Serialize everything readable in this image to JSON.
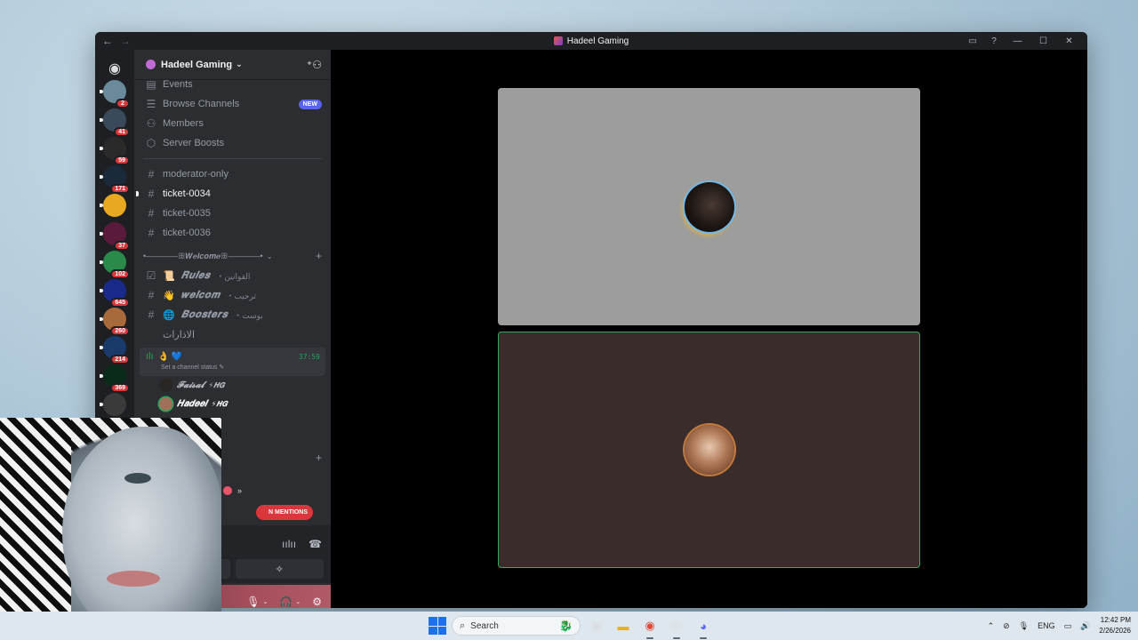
{
  "window": {
    "title": "Hadeel Gaming",
    "nav_back": "←",
    "nav_forward": "→",
    "controls": {
      "inbox_icon": "inbox-icon",
      "help_icon": "help-icon",
      "minimize": "—",
      "maximize": "☐",
      "close": "✕"
    }
  },
  "rail": {
    "home_icon": "discord-logo-icon",
    "servers": [
      {
        "badge": "2",
        "color": "#6a8a9c"
      },
      {
        "badge": "41",
        "color": "#3a4a5a"
      },
      {
        "badge": "59",
        "color": "#2a2a2a"
      },
      {
        "badge": "171",
        "color": "#1a2a3a"
      },
      {
        "badge": "",
        "color": "#e8a820"
      },
      {
        "badge": "37",
        "color": "#5a1a3a"
      },
      {
        "badge": "102",
        "color": "#2a8a4a"
      },
      {
        "badge": "645",
        "color": "#1a2a8a"
      },
      {
        "badge": "260",
        "color": "#a86a3a"
      },
      {
        "badge": "214",
        "color": "#1a3a6a"
      },
      {
        "badge": "369",
        "color": "#0a2a1a"
      },
      {
        "badge": "",
        "color": "#3a3a3a"
      }
    ]
  },
  "server": {
    "name": "Hadeel Gaming",
    "nav": [
      {
        "label": "Events",
        "icon": "calendar-icon"
      },
      {
        "label": "Browse Channels",
        "icon": "browse-channels-icon",
        "badge": "NEW"
      },
      {
        "label": "Members",
        "icon": "members-icon"
      },
      {
        "label": "Server Boosts",
        "icon": "boost-icon"
      }
    ],
    "channels": [
      {
        "name": "moderator-only",
        "active": false
      },
      {
        "name": "ticket-0034",
        "active": true
      },
      {
        "name": "ticket-0035",
        "active": false
      },
      {
        "name": "ticket-0036",
        "active": false
      }
    ],
    "category_welcome": "•————ꕥ𝑾𝒆𝒍𝒄𝒐𝒎𝒆ꕥ————•",
    "welcome_channels": [
      {
        "emoji": "📜",
        "name": "𝑹𝒖𝒍𝒆𝒔",
        "sub": "・القوانين"
      },
      {
        "emoji": "👋",
        "name": "𝒘𝒆𝒍𝒄𝒐𝒎",
        "sub": "・ترحيب"
      },
      {
        "emoji": "🌐",
        "name": "𝑩𝒐𝒐𝒔𝒕𝒆𝒓𝒔",
        "sub": "・بوست"
      },
      {
        "emoji": "",
        "name": "الاذارات",
        "sub": ""
      }
    ],
    "voice_channel": {
      "emoji": "👌 💙",
      "timer": "37:59",
      "status": "Set a channel status ✎",
      "users": [
        {
          "name": "𝓕𝓪𝓲𝓼𝓪𝓵",
          "tag": "⚡𝑯𝑮"
        },
        {
          "name": "𝑯𝒂𝒅𝒆𝒆𝒍",
          "tag": "⚡𝑯𝑮"
        }
      ]
    },
    "mentions_label": "N MENTIONS",
    "more_label": "»"
  },
  "voice_panel": {
    "icons": [
      "soundboard-icon",
      "disconnect-icon"
    ],
    "buttons": [
      "activities-icon",
      "soundboard-toggle-icon"
    ]
  },
  "user_panel": {
    "icons": [
      "mic-icon",
      "headphones-icon",
      "settings-gear-icon"
    ]
  },
  "taskbar": {
    "search_label": "Search",
    "tray": {
      "lang": "ENG",
      "time": "12:42 PM",
      "date": "2/26/2026"
    }
  }
}
